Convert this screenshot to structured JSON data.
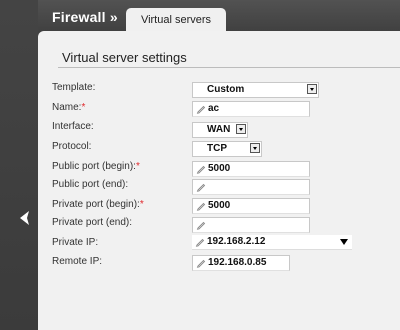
{
  "header": {
    "section_title": "Firewall »",
    "active_tab": "Virtual servers"
  },
  "panel": {
    "title": "Virtual server settings"
  },
  "form": {
    "template": {
      "label": "Template:",
      "value": "Custom"
    },
    "name": {
      "label": "Name:",
      "required": "*",
      "value": "ac"
    },
    "interface": {
      "label": "Interface:",
      "value": "WAN"
    },
    "protocol": {
      "label": "Protocol:",
      "value": "TCP"
    },
    "public_port_begin": {
      "label": "Public port (begin):",
      "required": "*",
      "value": "5000"
    },
    "public_port_end": {
      "label": "Public port (end):",
      "value": ""
    },
    "private_port_begin": {
      "label": "Private port (begin):",
      "required": "*",
      "value": "5000"
    },
    "private_port_end": {
      "label": "Private port (end):",
      "value": ""
    },
    "private_ip": {
      "label": "Private IP:",
      "value": "192.168.2.12"
    },
    "remote_ip": {
      "label": "Remote IP:",
      "value": "192.168.0.85"
    }
  },
  "icons": {
    "back": "chevron-left-icon",
    "edit": "pencil-icon",
    "dropdown": "caret-down-icon"
  },
  "colors": {
    "required": "#e0262a",
    "panel_bg": "#f1f1f1",
    "header_bg": "#3f3f3f"
  }
}
